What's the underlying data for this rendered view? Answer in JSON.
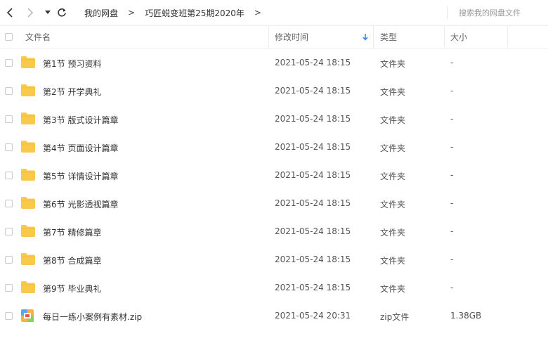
{
  "breadcrumb": {
    "items": [
      "我的网盘",
      "巧匠蜕变班第25期2020年"
    ],
    "separator": ">"
  },
  "search": {
    "placeholder": "搜索我的网盘文件"
  },
  "columns": {
    "name": "文件名",
    "modified": "修改时间",
    "type": "类型",
    "size": "大小"
  },
  "sort": {
    "column": "modified",
    "direction": "desc",
    "icon": "sort-down-arrow-icon",
    "color": "#1a8cff"
  },
  "folder_color": "#f9c94a",
  "files": [
    {
      "name": "第1节 预习资料",
      "modified": "2021-05-24 18:15",
      "type": "文件夹",
      "size": "-",
      "icon": "folder"
    },
    {
      "name": "第2节 开学典礼",
      "modified": "2021-05-24 18:15",
      "type": "文件夹",
      "size": "-",
      "icon": "folder"
    },
    {
      "name": "第3节 版式设计篇章",
      "modified": "2021-05-24 18:15",
      "type": "文件夹",
      "size": "-",
      "icon": "folder"
    },
    {
      "name": "第4节 页面设计篇章",
      "modified": "2021-05-24 18:15",
      "type": "文件夹",
      "size": "-",
      "icon": "folder"
    },
    {
      "name": "第5节 详情设计篇章",
      "modified": "2021-05-24 18:15",
      "type": "文件夹",
      "size": "-",
      "icon": "folder"
    },
    {
      "name": "第6节 光影透视篇章",
      "modified": "2021-05-24 18:15",
      "type": "文件夹",
      "size": "-",
      "icon": "folder"
    },
    {
      "name": "第7节 精修篇章",
      "modified": "2021-05-24 18:15",
      "type": "文件夹",
      "size": "-",
      "icon": "folder"
    },
    {
      "name": "第8节 合成篇章",
      "modified": "2021-05-24 18:15",
      "type": "文件夹",
      "size": "-",
      "icon": "folder"
    },
    {
      "name": "第9节 毕业典礼",
      "modified": "2021-05-24 18:15",
      "type": "文件夹",
      "size": "-",
      "icon": "folder"
    },
    {
      "name": "每日一练小案例有素材.zip",
      "modified": "2021-05-24 20:31",
      "type": "zip文件",
      "size": "1.38GB",
      "icon": "zip"
    }
  ]
}
